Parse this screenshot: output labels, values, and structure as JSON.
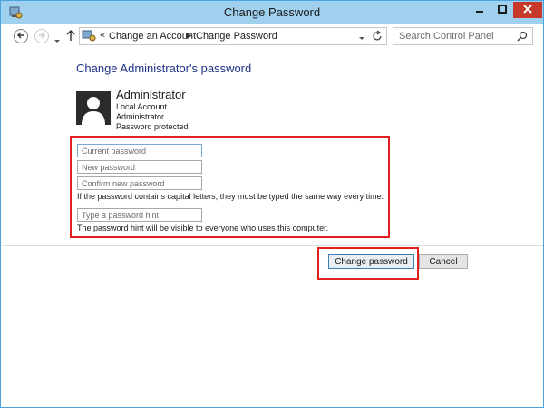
{
  "window": {
    "title": "Change Password"
  },
  "navigation": {
    "breadcrumb": [
      "Change an Account",
      "Change Password"
    ],
    "breadcrumb_prefix": "«",
    "search_placeholder": "Search Control Panel"
  },
  "main": {
    "heading": "Change Administrator's password",
    "user": {
      "name": "Administrator",
      "details": [
        "Local Account",
        "Administrator",
        "Password protected"
      ]
    },
    "form": {
      "current_password_placeholder": "Current password",
      "new_password_placeholder": "New password",
      "confirm_password_placeholder": "Confirm new password",
      "case_note": "If the password contains capital letters, they must be typed the same way every time.",
      "hint_placeholder": "Type a password hint",
      "hint_note": "The password hint will be visible to everyone who uses this computer."
    },
    "buttons": {
      "change_label": "Change password",
      "cancel_label": "Cancel"
    }
  },
  "colors": {
    "titlebar": "#9fd1ef",
    "close_button": "#c7392b",
    "heading_text": "#1e3287",
    "highlight_border": "#e02020"
  },
  "icons": [
    "control-panel-icon",
    "minimize-icon",
    "maximize-icon",
    "close-icon",
    "back-arrow-icon",
    "forward-arrow-icon",
    "chevron-down-icon",
    "up-arrow-icon",
    "refresh-icon",
    "search-icon",
    "user-avatar-icon"
  ]
}
